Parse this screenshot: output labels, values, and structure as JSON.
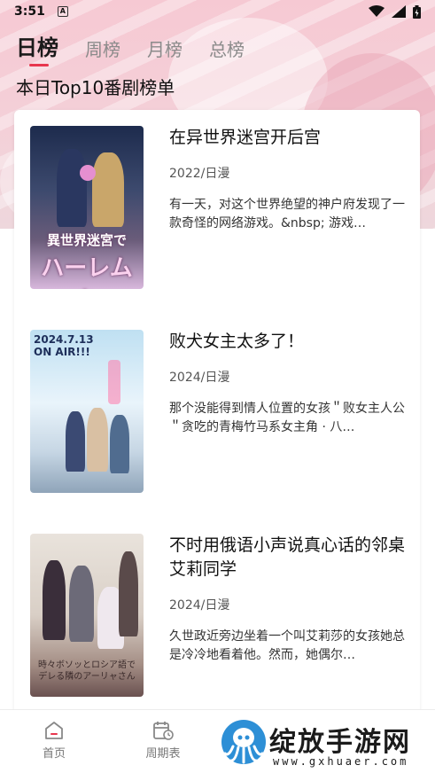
{
  "status_bar": {
    "time": "3:51",
    "indicator": "A"
  },
  "tabs": [
    {
      "label": "日榜",
      "active": true
    },
    {
      "label": "周榜",
      "active": false
    },
    {
      "label": "月榜",
      "active": false
    },
    {
      "label": "总榜",
      "active": false
    }
  ],
  "heading": "本日Top10番剧榜单",
  "items": [
    {
      "title": "在异世界迷宫开后宫",
      "meta": "2022/日漫",
      "desc": "有一天，对这个世界绝望的神户府发现了一款奇怪的网络游戏。&nbsp; 游戏…",
      "cover_text": [
        "異世界迷宮で",
        "ハーレムを"
      ]
    },
    {
      "title": "败犬女主太多了！",
      "meta": "2024/日漫",
      "desc": "那个没能得到情人位置的女孩＂败女主人公＂贪吃的青梅竹马系女主角 · 八…",
      "cover_text": [
        "2024.7.13",
        "ON AIR!!!"
      ]
    },
    {
      "title": "不时用俄语小声说真心话的邻桌艾莉同学",
      "meta": "2024/日漫",
      "desc": "久世政近旁边坐着一个叫艾莉莎的女孩她总是冷冷地看着他。然而，她偶尔…",
      "cover_text": [
        "時々ボソッとロシア語で",
        "デレる隣のアーリャさん"
      ]
    }
  ],
  "bottom_nav": [
    {
      "label": "首页",
      "icon": "home-icon"
    },
    {
      "label": "周期表",
      "icon": "calendar-clock-icon"
    }
  ],
  "watermark": {
    "title": "绽放手游网",
    "url": "www.gxhuaer.com"
  },
  "colors": {
    "accent": "#e8364e",
    "hero_bg": "#f4d0d8"
  }
}
